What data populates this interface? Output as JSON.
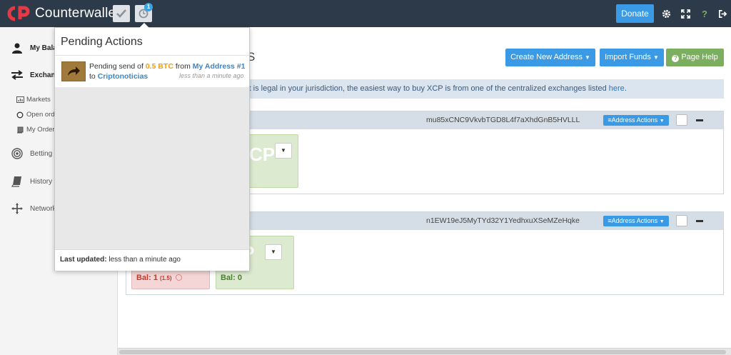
{
  "app": {
    "brand": "Counterwallet",
    "badge_count": "1",
    "donate_label": "Donate",
    "help_symbol": "?"
  },
  "sidebar": {
    "items": [
      {
        "label": "My Bala",
        "icon": "user-icon"
      },
      {
        "label": "Exchang",
        "icon": "exchange-icon"
      },
      {
        "label": "Markets",
        "icon": "bar-chart-icon"
      },
      {
        "label": "Open ord",
        "icon": "circle-icon"
      },
      {
        "label": "My Order",
        "icon": "book-icon"
      },
      {
        "label": "Betting",
        "icon": "target-icon"
      },
      {
        "label": "History",
        "icon": "history-book-icon"
      },
      {
        "label": "Network",
        "icon": "network-icon"
      }
    ]
  },
  "main": {
    "title_fragment": "S",
    "create_address_label": "Create New Address",
    "import_funds_label": "Import Funds",
    "page_help_label": "Page Help",
    "info_text": "t it is legal in your jurisdiction, the easiest way to buy XCP is from one of the centralized exchanges listed ",
    "info_link": "here",
    "info_end": ".",
    "addresses": [
      {
        "address": "mu85xCNC9VkvbTGD8L4f7aXhdGnB5HVLLL",
        "actions_label": "Address Actions",
        "asset_fragment": "CP",
        "balance_fragment": "0"
      },
      {
        "address": "n1EW19eJ5MyTYd32Y1YedhxuXSeMZeHqke",
        "actions_label": "Address Actions",
        "asset_fragment": "P",
        "btc_balance_label": "Bal: 1",
        "btc_balance_pending": "(1.5)",
        "xcp_balance_label": "Bal: 0"
      }
    ]
  },
  "popover": {
    "title": "Pending Actions",
    "item_prefix": "Pending send of ",
    "item_amount": "0.5 BTC",
    "item_from": " from ",
    "item_source": "My Address #1",
    "item_to": " to ",
    "item_dest": "Criptonoticias",
    "item_time": "less than a minute ago",
    "footer_label": "Last updated:",
    "footer_value": "less than a minute ago"
  },
  "colors": {
    "topbar": "#2c3a4a",
    "primary": "#3a9ae6",
    "success": "#7cae5f",
    "logo_red": "#e63946"
  }
}
